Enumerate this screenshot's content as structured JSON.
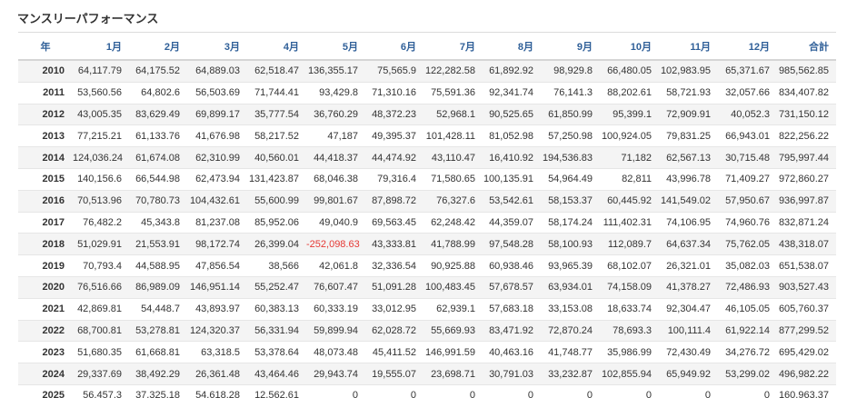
{
  "title": "マンスリーパフォーマンス",
  "headers": [
    "年",
    "1月",
    "2月",
    "3月",
    "4月",
    "5月",
    "6月",
    "7月",
    "8月",
    "9月",
    "10月",
    "11月",
    "12月",
    "合計"
  ],
  "rows": [
    {
      "year": "2010",
      "values": [
        "64,117.79",
        "64,175.52",
        "64,889.03",
        "62,518.47",
        "136,355.17",
        "75,565.9",
        "122,282.58",
        "61,892.92",
        "98,929.8",
        "66,480.05",
        "102,983.95",
        "65,371.67",
        "985,562.85"
      ]
    },
    {
      "year": "2011",
      "values": [
        "53,560.56",
        "64,802.6",
        "56,503.69",
        "71,744.41",
        "93,429.8",
        "71,310.16",
        "75,591.36",
        "92,341.74",
        "76,141.3",
        "88,202.61",
        "58,721.93",
        "32,057.66",
        "834,407.82"
      ]
    },
    {
      "year": "2012",
      "values": [
        "43,005.35",
        "83,629.49",
        "69,899.17",
        "35,777.54",
        "36,760.29",
        "48,372.23",
        "52,968.1",
        "90,525.65",
        "61,850.99",
        "95,399.1",
        "72,909.91",
        "40,052.3",
        "731,150.12"
      ]
    },
    {
      "year": "2013",
      "values": [
        "77,215.21",
        "61,133.76",
        "41,676.98",
        "58,217.52",
        "47,187",
        "49,395.37",
        "101,428.11",
        "81,052.98",
        "57,250.98",
        "100,924.05",
        "79,831.25",
        "66,943.01",
        "822,256.22"
      ]
    },
    {
      "year": "2014",
      "values": [
        "124,036.24",
        "61,674.08",
        "62,310.99",
        "40,560.01",
        "44,418.37",
        "44,474.92",
        "43,110.47",
        "16,410.92",
        "194,536.83",
        "71,182",
        "62,567.13",
        "30,715.48",
        "795,997.44"
      ]
    },
    {
      "year": "2015",
      "values": [
        "140,156.6",
        "66,544.98",
        "62,473.94",
        "131,423.87",
        "68,046.38",
        "79,316.4",
        "71,580.65",
        "100,135.91",
        "54,964.49",
        "82,811",
        "43,996.78",
        "71,409.27",
        "972,860.27"
      ]
    },
    {
      "year": "2016",
      "values": [
        "70,513.96",
        "70,780.73",
        "104,432.61",
        "55,600.99",
        "99,801.67",
        "87,898.72",
        "76,327.6",
        "53,542.61",
        "58,153.37",
        "60,445.92",
        "141,549.02",
        "57,950.67",
        "936,997.87"
      ]
    },
    {
      "year": "2017",
      "values": [
        "76,482.2",
        "45,343.8",
        "81,237.08",
        "85,952.06",
        "49,040.9",
        "69,563.45",
        "62,248.42",
        "44,359.07",
        "58,174.24",
        "111,402.31",
        "74,106.95",
        "74,960.76",
        "832,871.24"
      ]
    },
    {
      "year": "2018",
      "values": [
        "51,029.91",
        "21,553.91",
        "98,172.74",
        "26,399.04",
        "-252,098.63",
        "43,333.81",
        "41,788.99",
        "97,548.28",
        "58,100.93",
        "112,089.7",
        "64,637.34",
        "75,762.05",
        "438,318.07"
      ]
    },
    {
      "year": "2019",
      "values": [
        "70,793.4",
        "44,588.95",
        "47,856.54",
        "38,566",
        "42,061.8",
        "32,336.54",
        "90,925.88",
        "60,938.46",
        "93,965.39",
        "68,102.07",
        "26,321.01",
        "35,082.03",
        "651,538.07"
      ]
    },
    {
      "year": "2020",
      "values": [
        "76,516.66",
        "86,989.09",
        "146,951.14",
        "55,252.47",
        "76,607.47",
        "51,091.28",
        "100,483.45",
        "57,678.57",
        "63,934.01",
        "74,158.09",
        "41,378.27",
        "72,486.93",
        "903,527.43"
      ]
    },
    {
      "year": "2021",
      "values": [
        "42,869.81",
        "54,448.7",
        "43,893.97",
        "60,383.13",
        "60,333.19",
        "33,012.95",
        "62,939.1",
        "57,683.18",
        "33,153.08",
        "18,633.74",
        "92,304.47",
        "46,105.05",
        "605,760.37"
      ]
    },
    {
      "year": "2022",
      "values": [
        "68,700.81",
        "53,278.81",
        "124,320.37",
        "56,331.94",
        "59,899.94",
        "62,028.72",
        "55,669.93",
        "83,471.92",
        "72,870.24",
        "78,693.3",
        "100,111.4",
        "61,922.14",
        "877,299.52"
      ]
    },
    {
      "year": "2023",
      "values": [
        "51,680.35",
        "61,668.81",
        "63,318.5",
        "53,378.64",
        "48,073.48",
        "45,411.52",
        "146,991.59",
        "40,463.16",
        "41,748.77",
        "35,986.99",
        "72,430.49",
        "34,276.72",
        "695,429.02"
      ]
    },
    {
      "year": "2024",
      "values": [
        "29,337.69",
        "38,492.29",
        "26,361.48",
        "43,464.46",
        "29,943.74",
        "19,555.07",
        "23,698.71",
        "30,791.03",
        "33,232.87",
        "102,855.94",
        "65,949.92",
        "53,299.02",
        "496,982.22"
      ]
    },
    {
      "year": "2025",
      "values": [
        "56,457.3",
        "37,325.18",
        "54,618.28",
        "12,562.61",
        "0",
        "0",
        "0",
        "0",
        "0",
        "0",
        "0",
        "0",
        "160,963.37"
      ]
    }
  ],
  "colors": {
    "header_text": "#2f5f98",
    "negative_text": "#e53935",
    "row_stripe": "#f4f4f4",
    "body_text": "#333333"
  }
}
